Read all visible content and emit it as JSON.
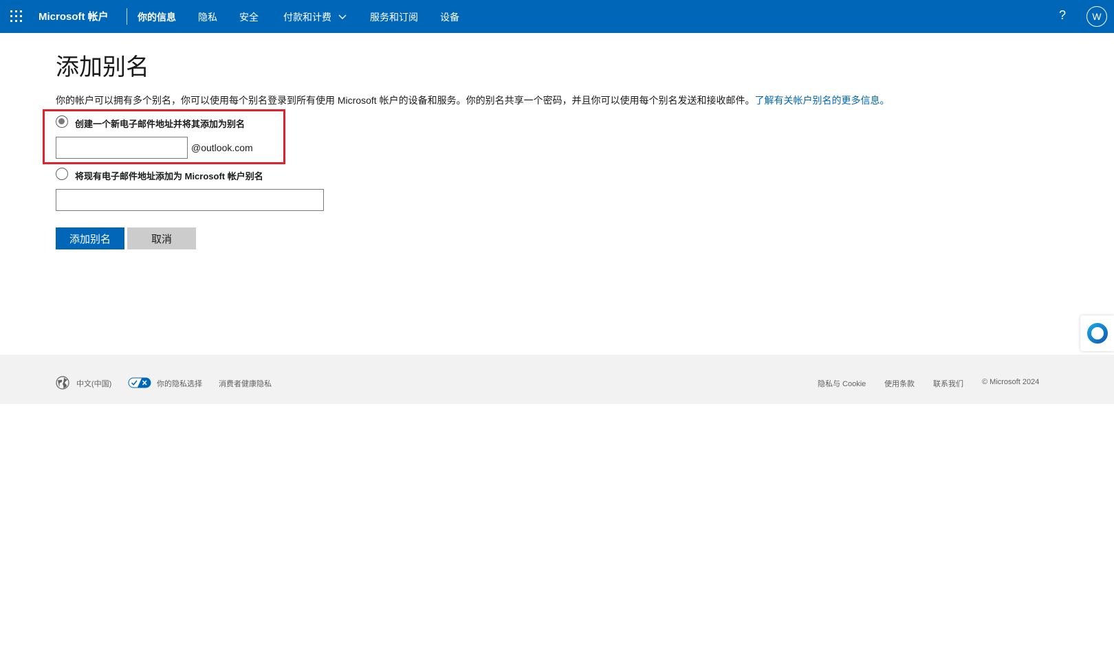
{
  "nav": {
    "brand": "Microsoft 帐户",
    "items": [
      {
        "label": "你的信息"
      },
      {
        "label": "隐私"
      },
      {
        "label": "安全"
      },
      {
        "label": "付款和计费"
      },
      {
        "label": "服务和订阅"
      },
      {
        "label": "设备"
      }
    ],
    "help": "?",
    "avatar_initial": "W"
  },
  "page": {
    "title": "添加别名",
    "description": "你的帐户可以拥有多个别名，你可以使用每个别名登录到所有使用 Microsoft 帐户的设备和服务。你的别名共享一个密码，并且你可以使用每个别名发送和接收邮件。",
    "learn_more_link": "了解有关帐户别名的更多信息。"
  },
  "form": {
    "option_new": {
      "label": "创建一个新电子邮件地址并将其添加为别名",
      "selected": true,
      "input_value": "",
      "domain_suffix": "@outlook.com"
    },
    "option_existing": {
      "label": "将现有电子邮件地址添加为 Microsoft 帐户别名",
      "selected": false,
      "input_value": ""
    },
    "submit_label": "添加别名",
    "cancel_label": "取消"
  },
  "footer": {
    "language": "中文(中国)",
    "privacy_choices": "你的隐私选择",
    "consumer_health_privacy": "消费者健康隐私",
    "privacy_cookies": "隐私与 Cookie",
    "terms_of_use": "使用条款",
    "contact_us": "联系我们",
    "copyright": "© Microsoft 2024"
  },
  "colors": {
    "nav_bg": "#0067b8",
    "primary_button": "#0067b8",
    "highlight_border": "#e3202b",
    "footer_bg": "#f2f2f2"
  }
}
